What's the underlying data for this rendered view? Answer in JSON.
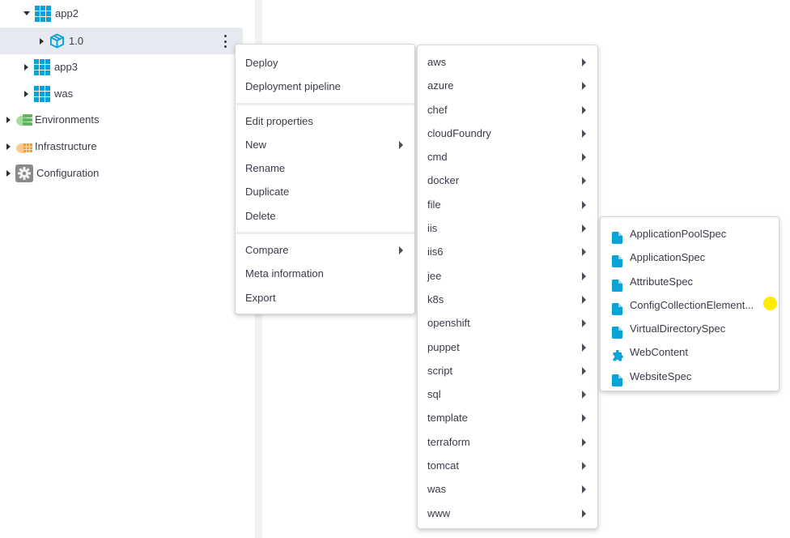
{
  "tree": {
    "items": [
      {
        "label": "app2",
        "icon": "application-grid-icon",
        "expanded": true
      },
      {
        "label": "1.0",
        "icon": "package-cube-icon",
        "expanded": false,
        "selected": true
      },
      {
        "label": "app3",
        "icon": "application-grid-icon",
        "expanded": false
      },
      {
        "label": "was",
        "icon": "application-grid-icon",
        "expanded": false
      },
      {
        "label": "Environments",
        "icon": "environments-cloud-icon",
        "expanded": false
      },
      {
        "label": "Infrastructure",
        "icon": "infrastructure-cloud-icon",
        "expanded": false
      },
      {
        "label": "Configuration",
        "icon": "configuration-gear-icon",
        "expanded": false
      }
    ]
  },
  "context_menu": {
    "groups": [
      [
        {
          "label": "Deploy"
        },
        {
          "label": "Deployment pipeline"
        }
      ],
      [
        {
          "label": "Edit properties"
        },
        {
          "label": "New",
          "submenu": true
        },
        {
          "label": "Rename"
        },
        {
          "label": "Duplicate"
        },
        {
          "label": "Delete"
        }
      ],
      [
        {
          "label": "Compare",
          "submenu": true
        },
        {
          "label": "Meta information"
        },
        {
          "label": "Export"
        }
      ]
    ]
  },
  "new_submenu": {
    "items": [
      "aws",
      "azure",
      "chef",
      "cloudFoundry",
      "cmd",
      "docker",
      "file",
      "iis",
      "iis6",
      "jee",
      "k8s",
      "openshift",
      "puppet",
      "script",
      "sql",
      "template",
      "terraform",
      "tomcat",
      "was",
      "www"
    ]
  },
  "iis_submenu": {
    "items": [
      {
        "label": "ApplicationPoolSpec",
        "icon": "file-icon"
      },
      {
        "label": "ApplicationSpec",
        "icon": "file-icon"
      },
      {
        "label": "AttributeSpec",
        "icon": "file-icon"
      },
      {
        "label": "ConfigCollectionElement...",
        "icon": "file-icon"
      },
      {
        "label": "VirtualDirectorySpec",
        "icon": "file-icon"
      },
      {
        "label": "WebContent",
        "icon": "puzzle-piece-icon"
      },
      {
        "label": "WebsiteSpec",
        "icon": "file-icon"
      }
    ]
  },
  "colors": {
    "accent": "#0aa3d8",
    "selected_row": "#e6e9ef",
    "environments": "#7cc576",
    "infrastructure": "#f5a53a",
    "configuration": "#8a8a8a",
    "cursor_highlight": "#ffea00"
  }
}
